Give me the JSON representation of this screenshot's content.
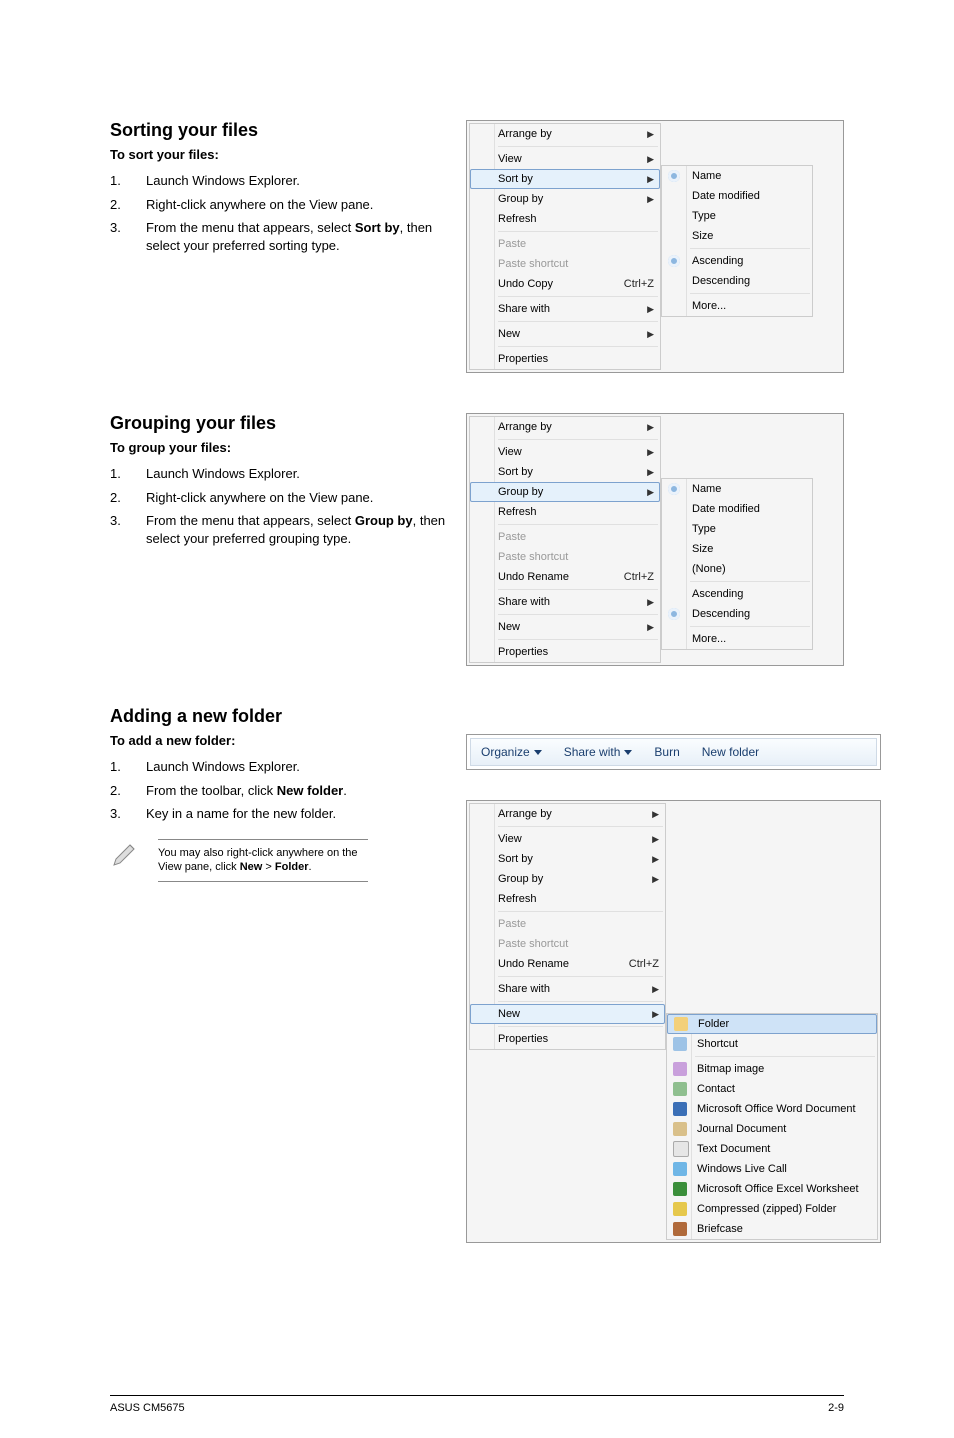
{
  "sort_section": {
    "heading": "Sorting your files",
    "sub": "To sort your files:",
    "steps": {
      "s1": "Launch Windows Explorer.",
      "s2": "Right-click anywhere on the View pane.",
      "s3_pre": "From the menu that appears, select ",
      "s3_bold": "Sort by",
      "s3_post": ", then select your preferred sorting type."
    },
    "menu": {
      "arrange": "Arrange by",
      "view": "View",
      "sortby": "Sort by",
      "groupby": "Group by",
      "refresh": "Refresh",
      "paste": "Paste",
      "paste_shortcut": "Paste shortcut",
      "undo": "Undo Copy",
      "undo_key": "Ctrl+Z",
      "share": "Share with",
      "new": "New",
      "props": "Properties"
    },
    "submenu": {
      "name": "Name",
      "date": "Date modified",
      "type": "Type",
      "size": "Size",
      "asc": "Ascending",
      "desc": "Descending",
      "more": "More..."
    }
  },
  "group_section": {
    "heading": "Grouping your files",
    "sub": "To group your files:",
    "steps": {
      "s1": "Launch Windows Explorer.",
      "s2": "Right-click anywhere on the View pane.",
      "s3_pre": "From the menu that appears, select ",
      "s3_bold": "Group by",
      "s3_post": ", then select your preferred grouping type."
    },
    "menu": {
      "arrange": "Arrange by",
      "view": "View",
      "sortby": "Sort by",
      "groupby": "Group by",
      "refresh": "Refresh",
      "paste": "Paste",
      "paste_shortcut": "Paste shortcut",
      "undo": "Undo Rename",
      "undo_key": "Ctrl+Z",
      "share": "Share with",
      "new": "New",
      "props": "Properties"
    },
    "submenu": {
      "name": "Name",
      "date": "Date modified",
      "type": "Type",
      "size": "Size",
      "none": "(None)",
      "asc": "Ascending",
      "desc": "Descending",
      "more": "More..."
    }
  },
  "add_section": {
    "heading": "Adding a new folder",
    "sub": "To add a new folder:",
    "steps": {
      "s1": "Launch Windows Explorer.",
      "s2_pre": "From the toolbar, click ",
      "s2_bold": "New folder",
      "s2_post": ".",
      "s3": "Key in a name for the new folder."
    },
    "note_pre": "You may also right-click anywhere on the View pane, click ",
    "note_b1": "New",
    "note_mid": " > ",
    "note_b2": "Folder",
    "note_post": ".",
    "toolbar": {
      "organize": "Organize",
      "share": "Share with",
      "burn": "Burn",
      "newfolder": "New folder"
    },
    "menu": {
      "arrange": "Arrange by",
      "view": "View",
      "sortby": "Sort by",
      "groupby": "Group by",
      "refresh": "Refresh",
      "paste": "Paste",
      "paste_shortcut": "Paste shortcut",
      "undo": "Undo Rename",
      "undo_key": "Ctrl+Z",
      "share": "Share with",
      "new": "New",
      "props": "Properties"
    },
    "submenu": {
      "folder": "Folder",
      "shortcut": "Shortcut",
      "bitmap": "Bitmap image",
      "contact": "Contact",
      "word": "Microsoft Office Word Document",
      "journal": "Journal Document",
      "text": "Text Document",
      "live": "Windows Live Call",
      "excel": "Microsoft Office Excel Worksheet",
      "zip": "Compressed (zipped) Folder",
      "brief": "Briefcase"
    }
  },
  "footer": {
    "left": "ASUS CM5675",
    "right": "2-9"
  }
}
